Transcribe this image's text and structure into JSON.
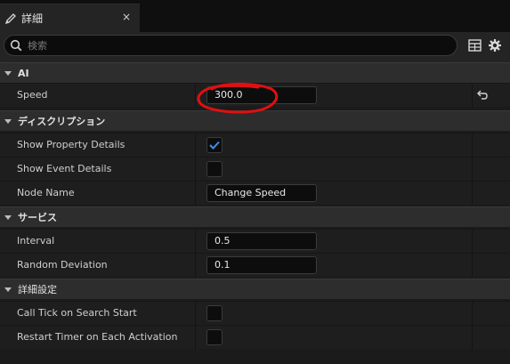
{
  "tab": {
    "label": "詳細",
    "close": "×",
    "icon": "pencil-icon"
  },
  "search": {
    "placeholder": "検索",
    "icon": "search-icon"
  },
  "toolbar": {
    "icons": [
      "table-icon",
      "gear-icon"
    ]
  },
  "sections": [
    {
      "label": "AI",
      "rows": [
        {
          "name": "Speed",
          "type": "text",
          "value": "300.0",
          "resettable": true
        }
      ]
    },
    {
      "label": "ディスクリプション",
      "rows": [
        {
          "name": "Show Property Details",
          "type": "checkbox",
          "checked": true
        },
        {
          "name": "Show Event Details",
          "type": "checkbox",
          "checked": false
        },
        {
          "name": "Node Name",
          "type": "text",
          "value": "Change Speed"
        }
      ]
    },
    {
      "label": "サービス",
      "rows": [
        {
          "name": "Interval",
          "type": "text",
          "value": "0.5"
        },
        {
          "name": "Random Deviation",
          "type": "text",
          "value": "0.1"
        }
      ]
    },
    {
      "label": "詳細設定",
      "rows": [
        {
          "name": "Call Tick on Search Start",
          "type": "checkbox",
          "checked": false
        },
        {
          "name": "Restart Timer on Each Activation",
          "type": "checkbox",
          "checked": false
        }
      ]
    }
  ],
  "colors": {
    "accent_check": "#3d8ff0",
    "annotation": "#e01010"
  }
}
